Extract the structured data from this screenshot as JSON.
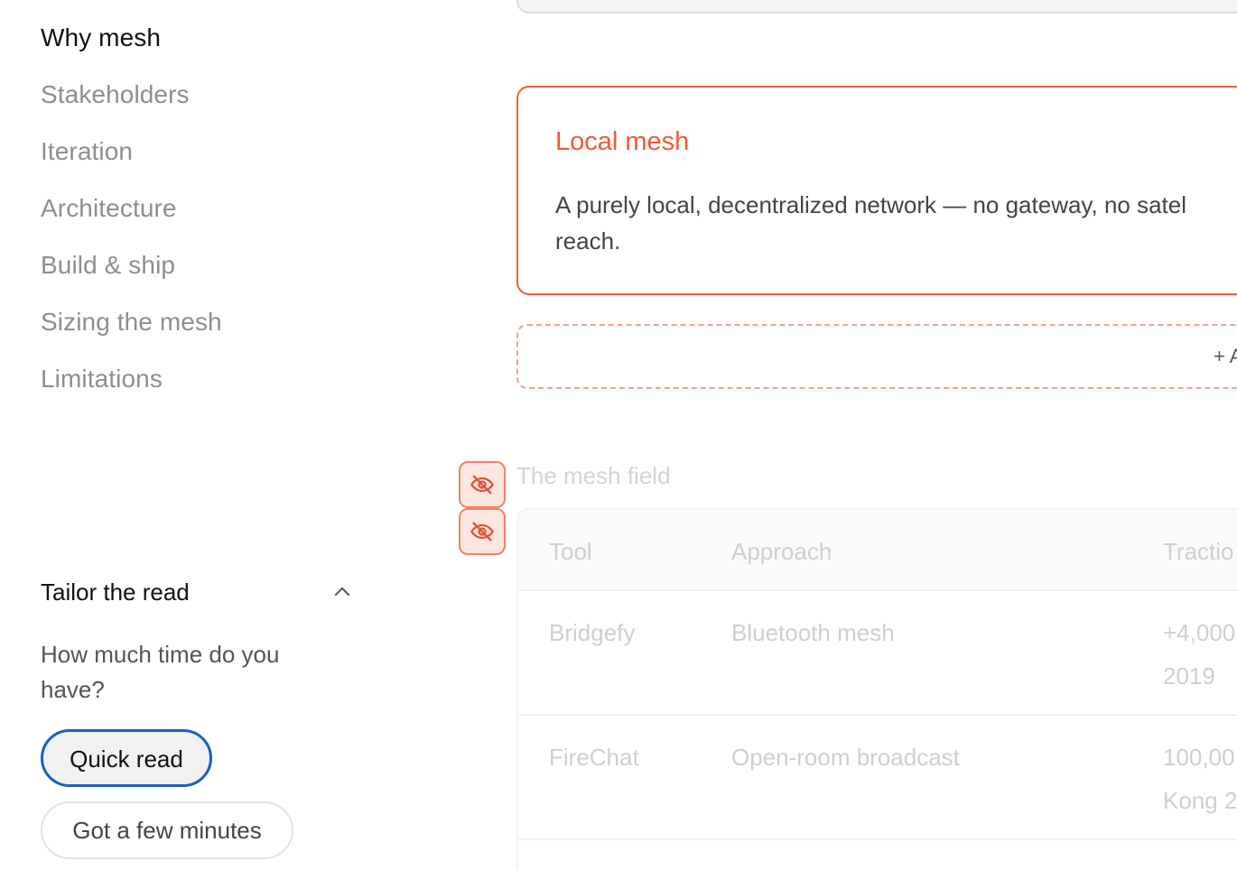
{
  "nav": {
    "items": [
      {
        "label": "Why mesh",
        "active": true
      },
      {
        "label": "Stakeholders",
        "active": false
      },
      {
        "label": "Iteration",
        "active": false
      },
      {
        "label": "Architecture",
        "active": false
      },
      {
        "label": "Build & ship",
        "active": false
      },
      {
        "label": "Sizing the mesh",
        "active": false
      },
      {
        "label": "Limitations",
        "active": false
      }
    ]
  },
  "tailor": {
    "title": "Tailor the read",
    "question": "How much time do you have?",
    "options": [
      {
        "label": "Quick read",
        "selected": true
      },
      {
        "label": "Got a few minutes",
        "selected": false
      }
    ]
  },
  "mesh_card": {
    "title": "Local mesh",
    "text": "A purely local, decentralized network — no gateway, no satel reach."
  },
  "add_card": {
    "label": "+ A"
  },
  "visibility_buttons": [
    "eye-off-icon",
    "eye-off-icon"
  ],
  "table": {
    "caption": "The mesh field",
    "headers": [
      "Tool",
      "Approach",
      "Tractio"
    ],
    "rows": [
      [
        "Bridgefy",
        "Bluetooth mesh",
        "+4,000 2019"
      ],
      [
        "FireChat",
        "Open-room broadcast",
        "100,00 Kong 2"
      ]
    ]
  },
  "colors": {
    "accent": "#ef5a35",
    "selected_outline": "#1a5fc4",
    "nav_muted": "#8e8e8e"
  }
}
